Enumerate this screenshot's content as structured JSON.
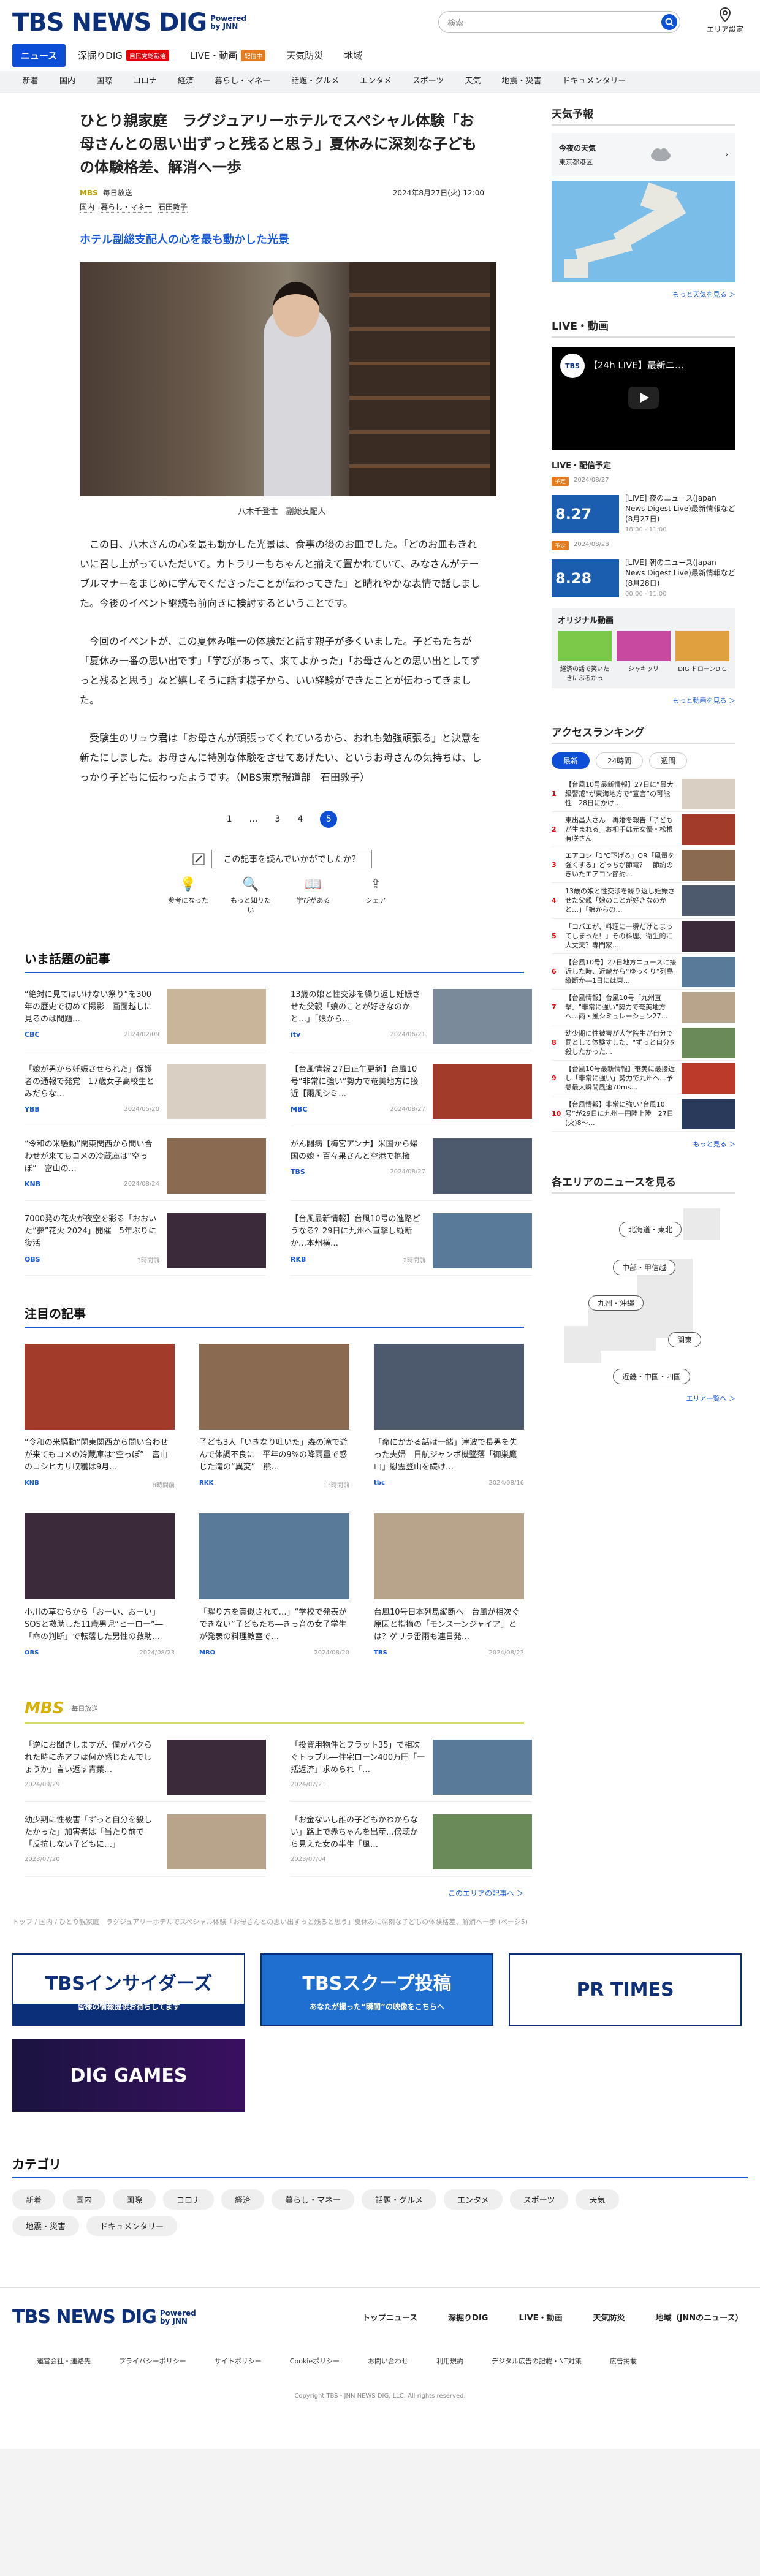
{
  "header": {
    "logo_text": "TBS NEWS DIG",
    "powered": "Powered by JNN",
    "search_placeholder": "検索",
    "area_label": "エリア設定",
    "nav": [
      {
        "label": "ニュース",
        "active": true
      },
      {
        "label": "深掘りDIG",
        "badge": "自民党総裁選",
        "badge_color": "#e5000a"
      },
      {
        "label": "LIVE・動画",
        "badge": "配信中",
        "badge_color": "#e57b1c"
      },
      {
        "label": "天気防災"
      },
      {
        "label": "地域"
      }
    ],
    "categories": [
      "新着",
      "国内",
      "国際",
      "コロナ",
      "経済",
      "暮らし・マネー",
      "話題・グルメ",
      "エンタメ",
      "スポーツ",
      "天気",
      "地震・災害",
      "ドキュメンタリー"
    ]
  },
  "article": {
    "title": "ひとり親家庭　ラグジュアリーホテルでスペシャル体験「お母さんとの思い出ずっと残ると思う」夏休みに深刻な子どもの体験格差、解消へ一歩",
    "source_logo": "MBS",
    "source": "毎日放送",
    "date": "2024年8月27日(火) 12:00",
    "tags": [
      "国内",
      "暮らし・マネー",
      "石田敦子"
    ],
    "subheading": "ホテル副総支配人の心を最も動かした光景",
    "caption": "八木千登世　副総支配人",
    "paragraphs": [
      "この日、八木さんの心を最も動かした光景は、食事の後のお皿でした。「どのお皿もきれいに召し上がっていただいて。カトラリーもちゃんと揃えて置かれていて、みなさんがテーブルマナーをまじめに学んでくださったことが伝わってきた」と晴れやかな表情で話しました。今後のイベント継続も前向きに検討するということです。",
      "今回のイベントが、この夏休み唯一の体験だと話す親子が多くいました。子どもたちが「夏休み一番の思い出です」「学びがあって、来てよかった」「お母さんとの思い出としてずっと残ると思う」など嬉しそうに話す様子から、いい経験ができたことが伝わってきました。",
      "受験生のリュウ君は「お母さんが頑張ってくれているから、おれも勉強頑張る」と決意を新たにしました。お母さんに特別な体験をさせてあげたい、というお母さんの気持ちは、しっかり子どもに伝わったようです。（MBS東京報道部　石田敦子）"
    ],
    "pages": [
      "1",
      "…",
      "3",
      "4",
      "5"
    ],
    "question": "この記事を読んでいかがでしたか？",
    "reactions": [
      "参考になった",
      "もっと知りたい",
      "学びがある",
      "シェア"
    ]
  },
  "trending": {
    "title": "いま話題の記事",
    "items": [
      {
        "text": "“絶対に見てはいけない祭り”を300年の歴史で初めて撮影　画面越しに見るのは問題…",
        "logo": "CBC",
        "date": "2024/02/09"
      },
      {
        "text": "13歳の娘と性交渉を繰り返し妊娠させた父親「娘のことが好きなのかと…」「娘から…",
        "logo": "itv",
        "date": "2024/06/21"
      },
      {
        "text": "「娘が男から妊娠させられた」保護者の通報で発覚　17歳女子高校生とみだらな…",
        "logo": "YBB",
        "date": "2024/05/20"
      },
      {
        "text": "【台風情報 27日正午更新】台風10号“非常に強い”勢力で奄美地方に接近【雨風シミ…",
        "logo": "MBC",
        "date": "2024/08/27"
      },
      {
        "text": "“令和の米騒動”閑東関西から問い合わせが来てもコメの冷蔵庫は“空っぽ”　富山の…",
        "logo": "KNB",
        "date": "2024/08/24"
      },
      {
        "text": "がん闘病【梅宮アンナ】米国から帰国の娘・百々果さんと空港で抱擁",
        "logo": "TBS",
        "date": "2024/08/27"
      },
      {
        "text": "7000発の花火が夜空を彩る「おおいた“夢”花火 2024」開催　5年ぶりに復活",
        "logo": "OBS",
        "date": "3時間前"
      },
      {
        "text": "【台風最新情報】台風10号の進路どうなる？29日に九州へ直撃し縦断か…本州横…",
        "logo": "RKB",
        "date": "2時間前"
      }
    ]
  },
  "featured": {
    "title": "注目の記事",
    "items": [
      {
        "text": "“令和の米騒動”閑東関西から問い合わせが来てもコメの冷蔵庫は“空っぽ”　富山のコシヒカリ収穫は9月…",
        "logo": "KNB",
        "date": "8時間前"
      },
      {
        "text": "子ども3人「いきなり吐いた」森の滝で遊んで体調不良に―平年の9%の降雨量で感じた滝の“異変”　熊…",
        "logo": "RKK",
        "date": "13時間前"
      },
      {
        "text": "「命にかかる話は一緒」津波で長男を失った夫婦　日航ジャンボ機墜落「御巣鷹山」慰霊登山を続け…",
        "logo": "tbc",
        "date": "2024/08/16"
      },
      {
        "text": "小川の草むらから「おーい、おーい」SOSと救助した11歳男児“ヒーロー”―「命の判断」で転落した男性の救助…",
        "logo": "OBS",
        "date": "2024/08/23"
      },
      {
        "text": "「曜り方を真似されて…」“学校で発表ができない”子どもたち―きっ音の女子学生が発表の料理教室で…",
        "logo": "MRO",
        "date": "2024/08/20"
      },
      {
        "text": "台風10号日本列島縦断へ　台風が相次ぐ原因と指摘の「モンスーンジャイア」とは？ゲリラ雷雨も連日発…",
        "logo": "TBS",
        "date": "2024/08/23"
      }
    ]
  },
  "mbs_section": {
    "logo": "MBS",
    "name": "毎日放送",
    "items": [
      {
        "text": "「逆にお聞きしますが、僕がバクられた時に赤アフは何か感じたんでしょうか」言い返す青葉…",
        "date": "2024/09/29"
      },
      {
        "text": "「投資用物件とフラット35」で相次ぐトラブル―住宅ローン400万円「一括返済」求められ「…",
        "date": "2024/02/21"
      },
      {
        "text": "幼少期に性被害「ずっと自分を殺したかった」加害者は「当たり前で「反抗しない子どもに…」",
        "date": "2023/07/20"
      },
      {
        "text": "「お金ないし誰の子どもかわからない」路上で赤ちゃんを出産…傍聴から見えた女の半生「風…",
        "date": "2023/07/04"
      }
    ],
    "more": "このエリアの記事へ ＞"
  },
  "breadcrumb": "トップ / 国内 / ひとり親家庭　ラグジュアリーホテルでスペシャル体験「お母さんとの思い出ずっと残ると思う」夏休みに深刻な子どもの体験格差、解消へ一歩 (ページ5)",
  "banners": [
    {
      "label": "TBSインサイダーズ",
      "sub": "皆様の情報提供お待ちしてます"
    },
    {
      "label": "TBSスクープ投稿",
      "sub": "あなたが撮った“瞬間”の映像をこちらへ"
    },
    {
      "label": "PR TIMES",
      "sub": ""
    },
    {
      "label": "DIG GAMES",
      "sub": ""
    }
  ],
  "category_section": {
    "title": "カテゴリ",
    "items": [
      "新着",
      "国内",
      "国際",
      "コロナ",
      "経済",
      "暮らし・マネー",
      "話題・グルメ",
      "エンタメ",
      "スポーツ",
      "天気",
      "地震・災害",
      "ドキュメンタリー"
    ]
  },
  "sidebar": {
    "weather_title": "天気予報",
    "weather_today": "今夜の天気",
    "weather_place": "東京都港区",
    "weather_more": "もっと天気を見る ＞",
    "live_title": "LIVE・動画",
    "live_video_title": "【24h LIVE】最新ニ…",
    "live_schedule": "LIVE・配信予定",
    "live_items": [
      {
        "badge": "予定",
        "date": "2024/08/27",
        "thumb": "8.27",
        "text": "[LIVE] 夜のニュース(Japan News Digest Live)最新情報など(8月27日)",
        "time": "18:00 - 11:00"
      },
      {
        "badge": "予定",
        "date": "2024/08/28",
        "thumb": "8.28",
        "text": "[LIVE] 朝のニュース(Japan News Digest Live)最新情報など(8月28日)",
        "time": "00:00 - 11:00"
      }
    ],
    "original_title": "オリジナル動画",
    "originals": [
      "経済の話で笑いたきにぶるかっ",
      "シャキッリ",
      "DIG ドローンDIG"
    ],
    "video_more": "もっと動画を見る ＞",
    "ranking_title": "アクセスランキング",
    "ranking_tabs": [
      "最新",
      "24時間",
      "週間"
    ],
    "ranking": [
      "【台風10号最新情報】27日に“最大級警戒”が東海地方で“宣言”の可能性　28日にかけ…",
      "東出昌大さん　再婚を報告「子どもが生まれる」お相手は元女優・松根有咲さん",
      "エアコン「1℃下げる」OR「風量を強くする」どっちが節電？　節約のきいたエアコン節約…",
      "13歳の娘と性交渉を繰り返し妊娠させた父親「娘のことが好きなのかと…」「娘からの…",
      "「コバエが、料理に一瞬だけとまってしまった！」その料理、衛生的に大丈夫？専門家…",
      "【台風10号】27日地方ニュースに接近した時、近畿から“ゆっくり”列島縦断か―1日には東…",
      "【台風情報】台風10号「九州直撃」\"非常に強い\"勢力で奄美地方へ…雨・風シミュレーション27…",
      "幼少期に性被害が大学院生が自分で罰として体験すした、“ずっと自分を殺したかった…",
      "【台風10号最新情報】奄美に最接近し「非常に強い」勢力で九州へ…予想最大瞬間風速70ms…",
      "【台風情報】非常に強い“台風10号”が29日に九州一円陸上陸　27日(火)8～…"
    ],
    "ranking_more": "もっと見る ＞",
    "area_title": "各エリアのニュースを見る",
    "areas": [
      "北海道・東北",
      "中部・甲信越",
      "九州・沖縄",
      "関東",
      "近畿・中国・四国"
    ],
    "area_more": "エリア一覧へ ＞"
  },
  "footer": {
    "logo_text": "TBS NEWS DIG",
    "powered": "Powered by JNN",
    "nav": [
      "トップニュース",
      "深掘りDIG",
      "LIVE・動画",
      "天気防災",
      "地域（JNNのニュース）"
    ],
    "links": [
      "運営会社・連絡先",
      "プライバシーポリシー",
      "サイトポリシー",
      "Cookieポリシー",
      "お問い合わせ",
      "利用規約",
      "デジタル広告の記載・NT対策",
      "広告掲載"
    ],
    "copyright": "Copyright TBS・JNN NEWS DIG, LLC. All rights reserved."
  }
}
